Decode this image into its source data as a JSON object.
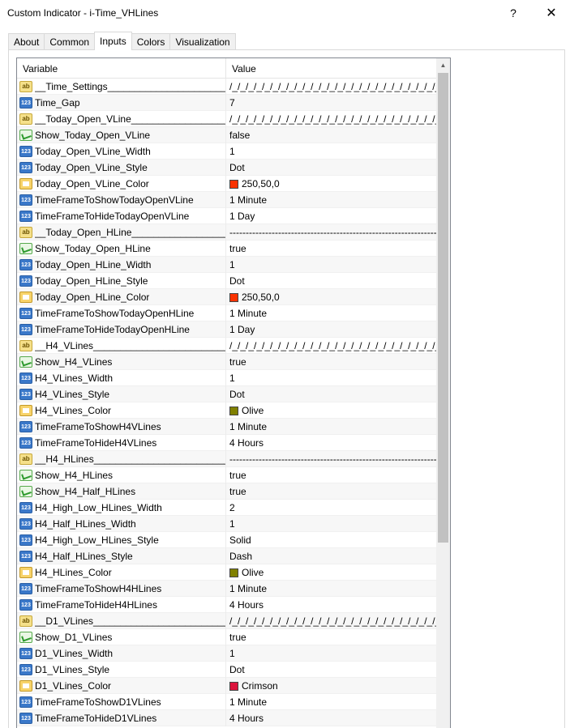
{
  "window": {
    "title": "Custom Indicator - i-Time_VHLines",
    "help_label": "?",
    "close_label": "✕"
  },
  "tabs": [
    {
      "label": "About"
    },
    {
      "label": "Common"
    },
    {
      "label": "Inputs"
    },
    {
      "label": "Colors"
    },
    {
      "label": "Visualization"
    }
  ],
  "active_tab": "Inputs",
  "grid": {
    "headers": {
      "variable": "Variable",
      "value": "Value"
    },
    "rows": [
      {
        "icon": "string-icon",
        "name": "__Time_Settings_______________________________",
        "value": "/_/_/_/_/_/_/_/_/_/_/_/_/_/_/_/_/_/_/_/_/_/_/_/_/_/_/_/_/"
      },
      {
        "icon": "integer-icon",
        "name": "Time_Gap",
        "value": "7"
      },
      {
        "icon": "string-icon",
        "name": "__Today_Open_VLine_______________________________",
        "value": "/_/_/_/_/_/_/_/_/_/_/_/_/_/_/_/_/_/_/_/_/_/_/_/_/_/_/_/_/"
      },
      {
        "icon": "bool-icon",
        "name": "Show_Today_Open_VLine",
        "value": "false"
      },
      {
        "icon": "integer-icon",
        "name": "Today_Open_VLine_Width",
        "value": "1"
      },
      {
        "icon": "integer-icon",
        "name": "Today_Open_VLine_Style",
        "value": "Dot"
      },
      {
        "icon": "color-icon",
        "name": "Today_Open_VLine_Color",
        "value": "250,50,0",
        "swatch": "#fa3200"
      },
      {
        "icon": "integer-icon",
        "name": "TimeFrameToShowTodayOpenVLine",
        "value": "1 Minute"
      },
      {
        "icon": "integer-icon",
        "name": "TimeFrameToHideTodayOpenVLine",
        "value": "1 Day"
      },
      {
        "icon": "string-icon",
        "name": "__Today_Open_HLine_______________________________",
        "value": "------------------------------------------------------------------------"
      },
      {
        "icon": "bool-icon",
        "name": "Show_Today_Open_HLine",
        "value": "true"
      },
      {
        "icon": "integer-icon",
        "name": "Today_Open_HLine_Width",
        "value": "1"
      },
      {
        "icon": "integer-icon",
        "name": "Today_Open_HLine_Style",
        "value": "Dot"
      },
      {
        "icon": "color-icon",
        "name": "Today_Open_HLine_Color",
        "value": "250,50,0",
        "swatch": "#fa3200"
      },
      {
        "icon": "integer-icon",
        "name": "TimeFrameToShowTodayOpenHLine",
        "value": "1 Minute"
      },
      {
        "icon": "integer-icon",
        "name": "TimeFrameToHideTodayOpenHLine",
        "value": "1 Day"
      },
      {
        "icon": "string-icon",
        "name": "__H4_VLines_______________________________",
        "value": "/_/_/_/_/_/_/_/_/_/_/_/_/_/_/_/_/_/_/_/_/_/_/_/_/_/_/_/_/"
      },
      {
        "icon": "bool-icon",
        "name": "Show_H4_VLines",
        "value": "true"
      },
      {
        "icon": "integer-icon",
        "name": "H4_VLines_Width",
        "value": "1"
      },
      {
        "icon": "integer-icon",
        "name": "H4_VLines_Style",
        "value": "Dot"
      },
      {
        "icon": "color-icon",
        "name": "H4_VLines_Color",
        "value": "Olive",
        "swatch": "#808000"
      },
      {
        "icon": "integer-icon",
        "name": "TimeFrameToShowH4VLines",
        "value": "1 Minute"
      },
      {
        "icon": "integer-icon",
        "name": "TimeFrameToHideH4VLines",
        "value": "4 Hours"
      },
      {
        "icon": "string-icon",
        "name": "__H4_HLines_______________________________",
        "value": "------------------------------------------------------------------------"
      },
      {
        "icon": "bool-icon",
        "name": "Show_H4_HLines",
        "value": "true"
      },
      {
        "icon": "bool-icon",
        "name": "Show_H4_Half_HLines",
        "value": "true"
      },
      {
        "icon": "integer-icon",
        "name": "H4_High_Low_HLines_Width",
        "value": "2"
      },
      {
        "icon": "integer-icon",
        "name": "H4_Half_HLines_Width",
        "value": "1"
      },
      {
        "icon": "integer-icon",
        "name": "H4_High_Low_HLines_Style",
        "value": "Solid"
      },
      {
        "icon": "integer-icon",
        "name": "H4_Half_HLines_Style",
        "value": "Dash"
      },
      {
        "icon": "color-icon",
        "name": "H4_HLines_Color",
        "value": "Olive",
        "swatch": "#808000"
      },
      {
        "icon": "integer-icon",
        "name": "TimeFrameToShowH4HLines",
        "value": "1 Minute"
      },
      {
        "icon": "integer-icon",
        "name": "TimeFrameToHideH4HLines",
        "value": "4 Hours"
      },
      {
        "icon": "string-icon",
        "name": "__D1_VLines_______________________________",
        "value": "/_/_/_/_/_/_/_/_/_/_/_/_/_/_/_/_/_/_/_/_/_/_/_/_/_/_/_/_/"
      },
      {
        "icon": "bool-icon",
        "name": "Show_D1_VLines",
        "value": "true"
      },
      {
        "icon": "integer-icon",
        "name": "D1_VLines_Width",
        "value": "1"
      },
      {
        "icon": "integer-icon",
        "name": "D1_VLines_Style",
        "value": "Dot"
      },
      {
        "icon": "color-icon",
        "name": "D1_VLines_Color",
        "value": "Crimson",
        "swatch": "#dc143c"
      },
      {
        "icon": "integer-icon",
        "name": "TimeFrameToShowD1VLines",
        "value": "1 Minute"
      },
      {
        "icon": "integer-icon",
        "name": "TimeFrameToHideD1VLines",
        "value": "4 Hours"
      }
    ]
  }
}
